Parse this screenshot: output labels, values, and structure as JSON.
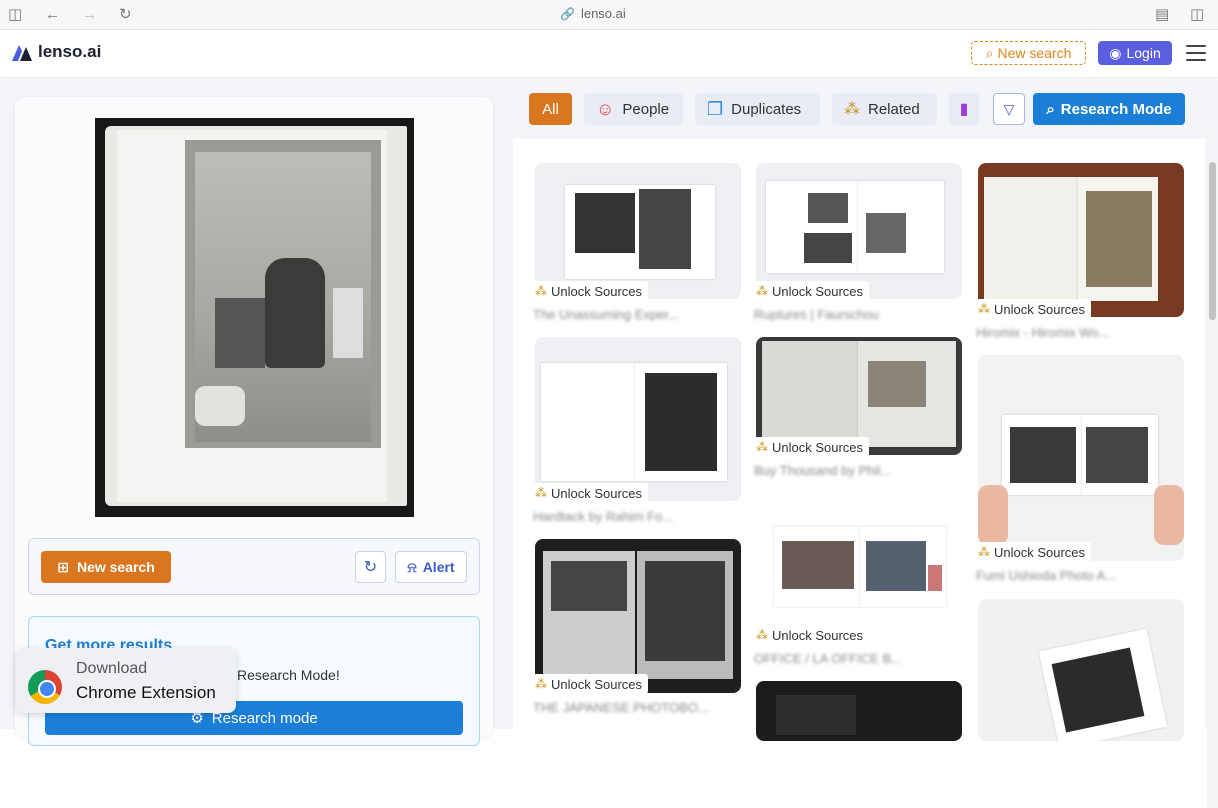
{
  "browser": {
    "url": "lenso.ai"
  },
  "header": {
    "brand": "lenso.ai",
    "new_search": "New search",
    "login": "Login"
  },
  "left": {
    "new_search": "New search",
    "alert": "Alert",
    "more_title": "Get more results",
    "more_text": "Research Mode!",
    "research_button": "Research mode",
    "chrome_line1": "Download",
    "chrome_line2": "Chrome Extension"
  },
  "filters": {
    "all": "All",
    "people": "People",
    "duplicates": "Duplicates",
    "related": "Related",
    "research_mode": "Research Mode"
  },
  "results": [
    {
      "label": "Unlock Sources",
      "title": "The Unassuming Exper..."
    },
    {
      "label": "Unlock Sources",
      "title": "Ruptures | Faurschou"
    },
    {
      "label": "Unlock Sources",
      "title": "Hiromix - Hiromix Wo..."
    },
    {
      "label": "Unlock Sources",
      "title": "Hardtack by Rahim Fo..."
    },
    {
      "label": "Unlock Sources",
      "title": "Buy Thousand by Phil..."
    },
    {
      "label": "Unlock Sources",
      "title": "Fumi Ushioda Photo A..."
    },
    {
      "label": "Unlock Sources",
      "title": "THE JAPANESE PHOTOBO..."
    },
    {
      "label": "Unlock Sources",
      "title": "OFFICE / LA OFFICE B..."
    }
  ],
  "colors": {
    "accent_orange": "#d9761f",
    "accent_blue": "#1b7fd8",
    "login_purple": "#5a5fe0"
  }
}
